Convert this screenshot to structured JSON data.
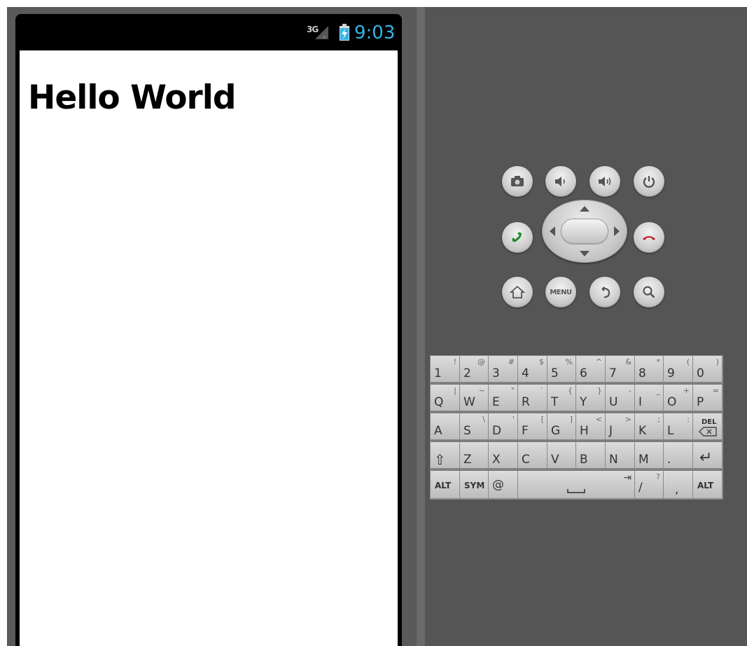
{
  "status_bar": {
    "network": "3G",
    "time": "9:03"
  },
  "app": {
    "text": "Hello World"
  },
  "hardware_buttons": {
    "row1": [
      "camera-icon",
      "volume-down-icon",
      "volume-up-icon",
      "power-icon"
    ],
    "row2": [
      "call-icon",
      "dpad",
      "end-call-icon"
    ],
    "row3": [
      "home-icon",
      "menu",
      "back-icon",
      "search-icon"
    ],
    "menu_label": "MENU"
  },
  "keyboard": {
    "row1": [
      [
        "1",
        "!"
      ],
      [
        "2",
        "@"
      ],
      [
        "3",
        "#"
      ],
      [
        "4",
        "$"
      ],
      [
        "5",
        "%"
      ],
      [
        "6",
        "^"
      ],
      [
        "7",
        "&"
      ],
      [
        "8",
        "*"
      ],
      [
        "9",
        "("
      ],
      [
        "0",
        ")"
      ]
    ],
    "row2": [
      [
        "Q",
        "|"
      ],
      [
        "W",
        "~"
      ],
      [
        "E",
        "\""
      ],
      [
        "R",
        "`"
      ],
      [
        "T",
        "{"
      ],
      [
        "Y",
        "}"
      ],
      [
        "U",
        "-"
      ],
      [
        "I",
        "_"
      ],
      [
        "O",
        "+"
      ],
      [
        "P",
        "="
      ]
    ],
    "row3": [
      [
        "A",
        ""
      ],
      [
        "S",
        "\\"
      ],
      [
        "D",
        "'"
      ],
      [
        "F",
        "["
      ],
      [
        "G",
        "]"
      ],
      [
        "H",
        "<"
      ],
      [
        "J",
        ">"
      ],
      [
        "K",
        ";"
      ],
      [
        "L",
        ":"
      ],
      [
        "DEL",
        ""
      ]
    ],
    "row4": [
      [
        "⇧",
        ""
      ],
      [
        "Z",
        ""
      ],
      [
        "X",
        ""
      ],
      [
        "C",
        ""
      ],
      [
        "V",
        ""
      ],
      [
        "B",
        ""
      ],
      [
        "N",
        ""
      ],
      [
        "M",
        ""
      ],
      [
        ".",
        ""
      ],
      [
        "↵",
        ""
      ]
    ],
    "row5": {
      "alt_left": "ALT",
      "sym": "SYM",
      "at": "@",
      "space_alt": "⇥",
      "slash": "/",
      "slash_alt": "?",
      "comma": ",",
      "alt_right": "ALT"
    }
  },
  "colors": {
    "time": "#33b5e5",
    "call_green": "#1f8a2a",
    "end_red": "#c8141e"
  }
}
